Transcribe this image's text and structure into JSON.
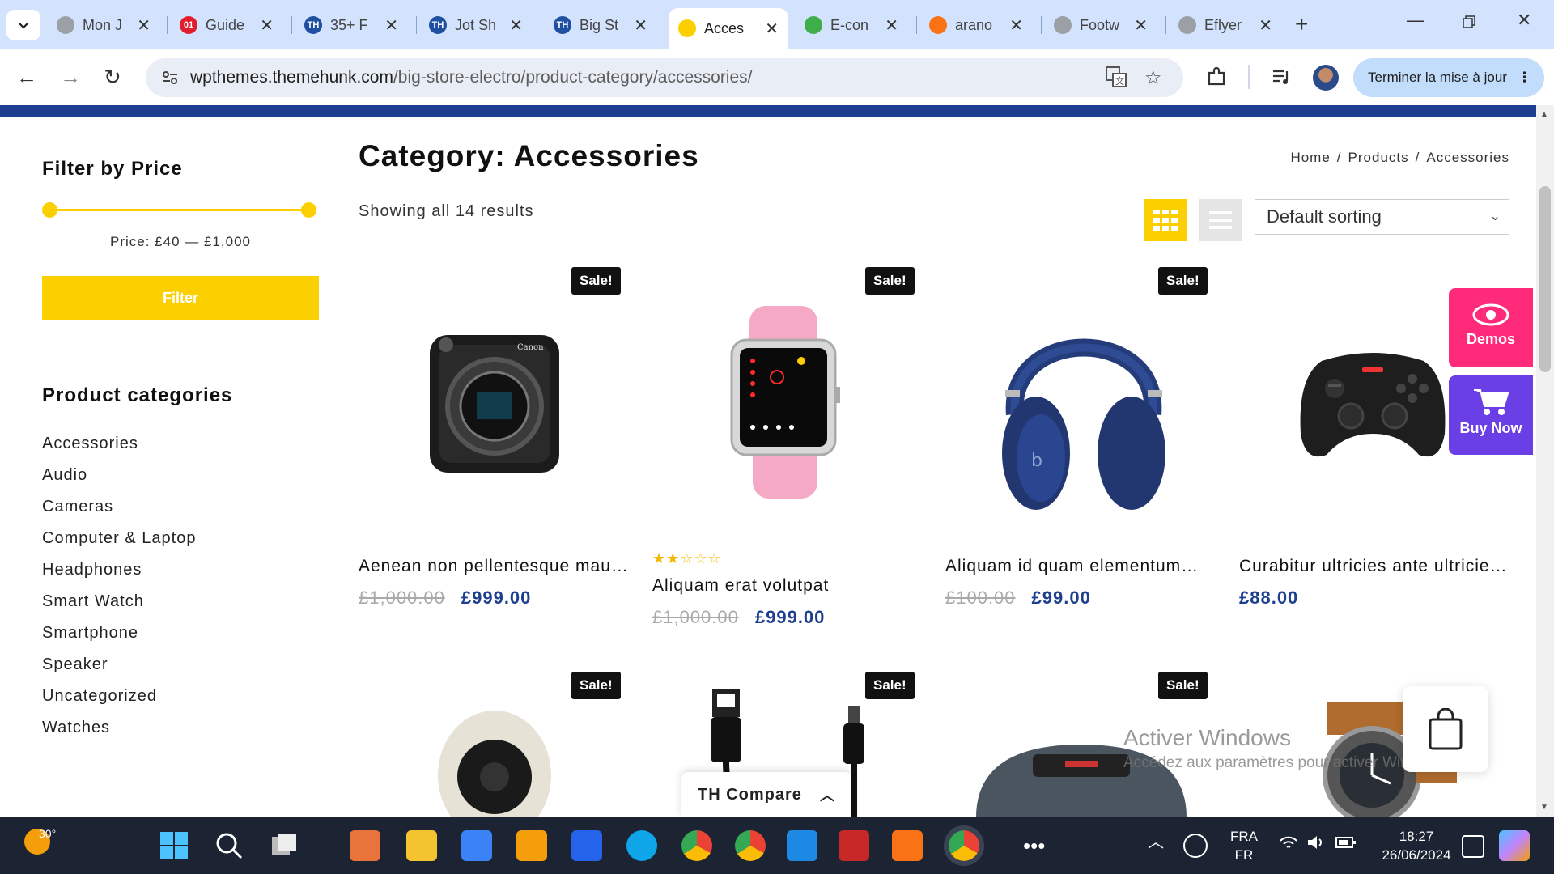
{
  "browser": {
    "tabs": [
      {
        "title": "Mon J",
        "color": "#9aa0a6",
        "letter": ""
      },
      {
        "title": "Guide",
        "color": "#e11d2e",
        "letter": "01"
      },
      {
        "title": "35+ F",
        "color": "#1e4fa0",
        "letter": "TH"
      },
      {
        "title": "Jot Sh",
        "color": "#1e4fa0",
        "letter": "TH"
      },
      {
        "title": "Big St",
        "color": "#1e4fa0",
        "letter": "TH"
      },
      {
        "title": "Acces",
        "color": "#fcd000",
        "letter": ""
      },
      {
        "title": "E-con",
        "color": "#3fae49",
        "letter": ""
      },
      {
        "title": "arano",
        "color": "#f97316",
        "letter": ""
      },
      {
        "title": "Footw",
        "color": "#9aa0a6",
        "letter": ""
      },
      {
        "title": "Eflyer",
        "color": "#9aa0a6",
        "letter": ""
      }
    ],
    "active_tab": 5,
    "url_host": "wpthemes.themehunk.com",
    "url_path": "/big-store-electro/product-category/accessories/",
    "profile_button": "Terminer la mise à jour"
  },
  "sidebar": {
    "price_title": "Filter by Price",
    "price_range": "Price: £40 — £1,000",
    "filter_button": "Filter",
    "categories_title": "Product categories",
    "categories": [
      "Accessories",
      "Audio",
      "Cameras",
      "Computer & Laptop",
      "Headphones",
      "Smart Watch",
      "Smartphone",
      "Speaker",
      "Uncategorized",
      "Watches"
    ]
  },
  "main": {
    "title": "Category: Accessories",
    "breadcrumb": [
      "Home",
      "/",
      "Products",
      "/",
      "Accessories"
    ],
    "result_count": "Showing all 14 results",
    "sort_label": "Default sorting",
    "sale_badge": "Sale!",
    "products": [
      {
        "name": "Aenean non pellentesque mauris",
        "old_price": "£1,000.00",
        "price": "£999.00",
        "sale": true,
        "rating": 0
      },
      {
        "name": "Aliquam erat volutpat",
        "old_price": "£1,000.00",
        "price": "£999.00",
        "sale": true,
        "rating": 2
      },
      {
        "name": "Aliquam id quam elementum…",
        "old_price": "£100.00",
        "price": "£99.00",
        "sale": true,
        "rating": 0
      },
      {
        "name": "Curabitur ultricies ante ultricie…",
        "old_price": "",
        "price": "£88.00",
        "sale": false,
        "rating": 0
      }
    ],
    "stars_display": "★★☆☆☆"
  },
  "floating": {
    "demos": "Demos",
    "buy_now": "Buy Now",
    "compare": "TH Compare"
  },
  "watermark": {
    "line1": "Activer Windows",
    "line2": "Accédez aux paramètres pour activer Windows."
  },
  "taskbar": {
    "temperature": "30°",
    "lang_top": "FRA",
    "lang_bottom": "FR",
    "time": "18:27",
    "date": "26/06/2024"
  }
}
